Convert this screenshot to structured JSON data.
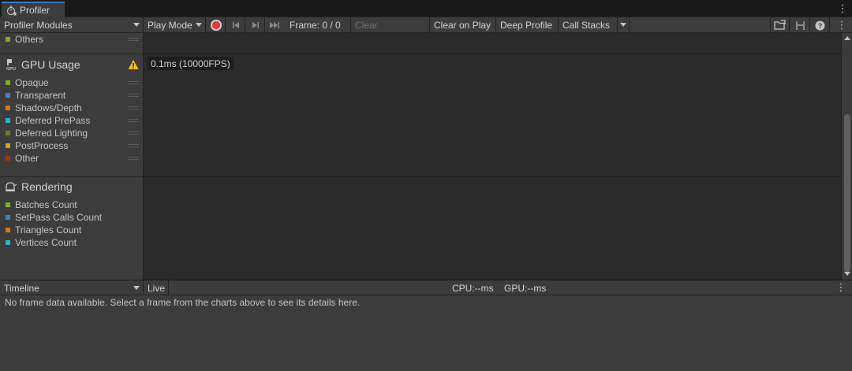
{
  "window": {
    "tab_title": "Profiler",
    "tab_icon": "profiler-stopwatch-icon"
  },
  "toolbar": {
    "modules_dropdown": "Profiler Modules",
    "play_mode_dropdown": "Play Mode",
    "record_icon": "record-icon",
    "frame_label": "Frame: 0 / 0",
    "clear_label": "Clear",
    "clear_on_play_label": "Clear on Play",
    "deep_profile_label": "Deep Profile",
    "call_stacks_label": "Call Stacks"
  },
  "modules": {
    "cpu_tail": {
      "items": [
        {
          "label": "Others",
          "color": "#7fae1b"
        }
      ]
    },
    "gpu": {
      "title": "GPU Usage",
      "warning": true,
      "items": [
        {
          "label": "Opaque",
          "color": "#7fae1b"
        },
        {
          "label": "Transparent",
          "color": "#3b84c4"
        },
        {
          "label": "Shadows/Depth",
          "color": "#d9761c"
        },
        {
          "label": "Deferred PrePass",
          "color": "#2fb4c4"
        },
        {
          "label": "Deferred Lighting",
          "color": "#6b7f1b"
        },
        {
          "label": "PostProcess",
          "color": "#c7a51d"
        },
        {
          "label": "Other",
          "color": "#a3331c"
        }
      ]
    },
    "rendering": {
      "title": "Rendering",
      "items": [
        {
          "label": "Batches Count",
          "color": "#7fae1b"
        },
        {
          "label": "SetPass Calls Count",
          "color": "#3b84c4"
        },
        {
          "label": "Triangles Count",
          "color": "#d9761c"
        },
        {
          "label": "Vertices Count",
          "color": "#2fb4c4"
        }
      ]
    }
  },
  "chart": {
    "gpu_tooltip": "0.1ms (10000FPS)"
  },
  "details": {
    "view_dropdown": "Timeline",
    "live_label": "Live",
    "cpu_label": "CPU:--ms",
    "gpu_label": "GPU:--ms",
    "message": "No frame data available. Select a frame from the charts above to see its details here."
  }
}
